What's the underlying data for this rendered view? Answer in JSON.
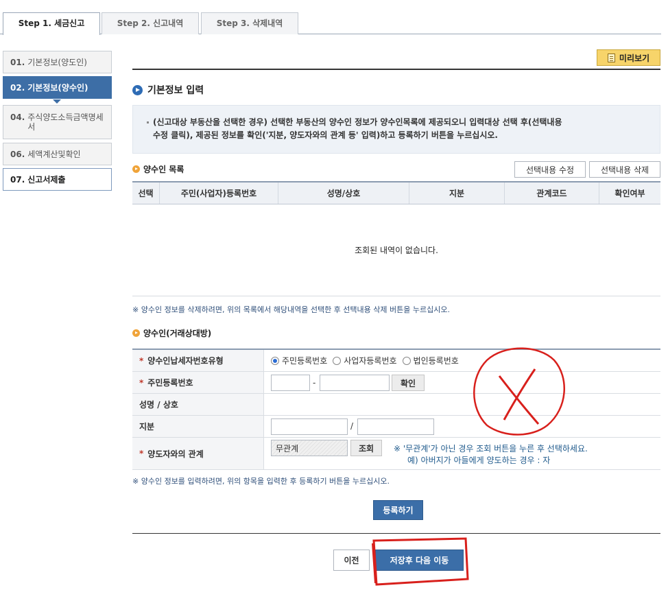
{
  "tabs": [
    {
      "label": "Step 1. 세금신고",
      "active": true
    },
    {
      "label": "Step 2. 신고내역",
      "active": false
    },
    {
      "label": "Step 3. 삭제내역",
      "active": false
    }
  ],
  "sidebar": {
    "items": [
      {
        "num": "01.",
        "label": "기본정보(양도인)"
      },
      {
        "num": "02.",
        "label": "기본정보(양수인)"
      },
      {
        "num": "04.",
        "label": "주식양도소득금액명세서"
      },
      {
        "num": "06.",
        "label": "세액계산및확인"
      },
      {
        "num": "07.",
        "label": "신고서제출"
      }
    ]
  },
  "preview_label": "미리보기",
  "section_title": "기본정보 입력",
  "notice": {
    "line1": "(신고대상 부동산을 선택한 경우) 선택한 부동산의 양수인 정보가 양수인목록에 제공되오니 입력대상 선택 후(선택내용",
    "line2": "수정 클릭), 제공된 정보를 확인('지분, 양도자와의 관계 등' 입력)하고 등록하기 버튼을 누르십시오."
  },
  "list": {
    "title": "양수인 목록",
    "edit_button": "선택내용 수정",
    "delete_button": "선택내용 삭제",
    "columns": [
      "선택",
      "주민(사업자)등록번호",
      "성명/상호",
      "지분",
      "관계코드",
      "확인여부"
    ],
    "empty_message": "조회된 내역이 없습니다.",
    "note": "※ 양수인 정보를 삭제하려면, 위의 목록에서 해당내역을 선택한 후 선택내용 삭제 버튼을 누르십시오."
  },
  "form": {
    "title": "양수인(거래상대방)",
    "type_label": "양수인납세자번호유형",
    "type_options": [
      "주민등록번호",
      "사업자등록번호",
      "법인등록번호"
    ],
    "type_selected": "주민등록번호",
    "id_label": "주민등록번호",
    "id_dash": "-",
    "confirm_button": "확인",
    "name_label": "성명 / 상호",
    "share_label": "지분",
    "share_sep": "/",
    "relation_label": "양도자와의 관계",
    "relation_value": "무관계",
    "lookup_button": "조회",
    "relation_hint1": "※ '무관계'가 아닌 경우 조회 버튼을 누른 후 선택하세요.",
    "relation_hint2": "예) 아버지가 아들에게 양도하는 경우 : 자",
    "note": "※ 양수인 정보를 입력하려면, 위의 항목을 입력한 후 등록하기 버튼을 누르십시오.",
    "register_button": "등록하기"
  },
  "footer": {
    "prev_button": "이전",
    "next_button": "저장후 다음 이동"
  }
}
